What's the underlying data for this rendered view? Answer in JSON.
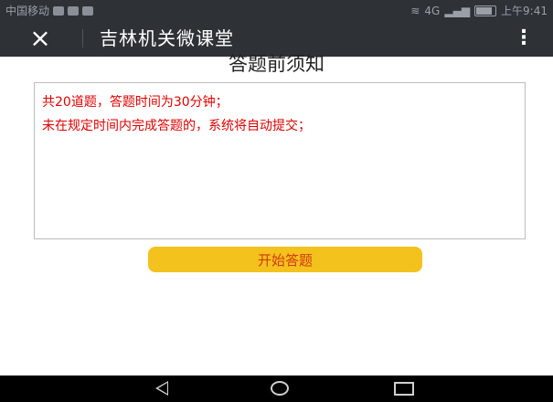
{
  "status_bar": {
    "carrier": "中国移动",
    "network": "4G",
    "time": "上午9:41",
    "icons": [
      "wechat-icon",
      "app-icon",
      "app-icon",
      "wifi-icon",
      "signal-icon",
      "battery-icon"
    ]
  },
  "header": {
    "close_icon": "×",
    "title": "吉林机关微课堂",
    "more_icon": "⋮"
  },
  "main": {
    "heading": "答题前须知",
    "notices": [
      "共20道题，答题时间为30分钟；",
      "未在规定时间内完成答题的，系统将自动提交；"
    ],
    "start_button_label": "开始答题"
  },
  "colors": {
    "title_bar": "#2e3237",
    "notice_text": "#e00000",
    "button_bg": "#f4c21d",
    "button_text": "#d23a10"
  }
}
